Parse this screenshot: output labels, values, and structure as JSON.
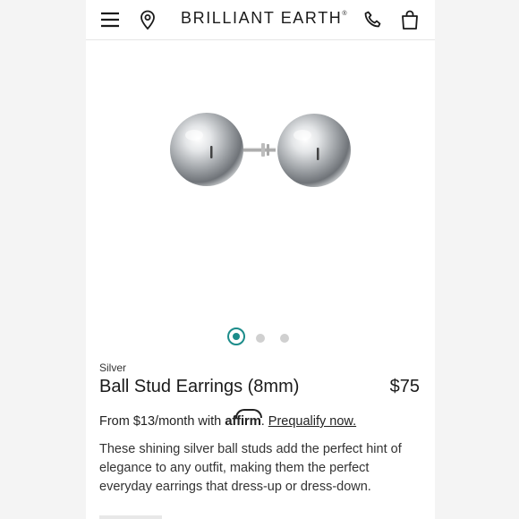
{
  "header": {
    "brand": "BRILLIANT EARTH",
    "trademark": "®",
    "icons": [
      "menu-icon",
      "location-pin-icon",
      "phone-icon",
      "shopping-bag-icon"
    ]
  },
  "gallery": {
    "image_alt": "Silver ball stud earrings",
    "total_slides": 3,
    "active_slide": 1
  },
  "product": {
    "metal": "Silver",
    "name": "Ball Stud Earrings (8mm)",
    "price": "$75"
  },
  "financing": {
    "prefix": "From $13/month with",
    "provider": "affirm",
    "separator": ".",
    "link": "Prequalify now."
  },
  "description": "These shining silver ball studs add the perfect hint of elegance to any outfit, making them the perfect everyday earrings that dress-up or dress-down.",
  "colors": {
    "accent": "#1c8c8a",
    "text": "#222222",
    "background": "#ffffff"
  }
}
